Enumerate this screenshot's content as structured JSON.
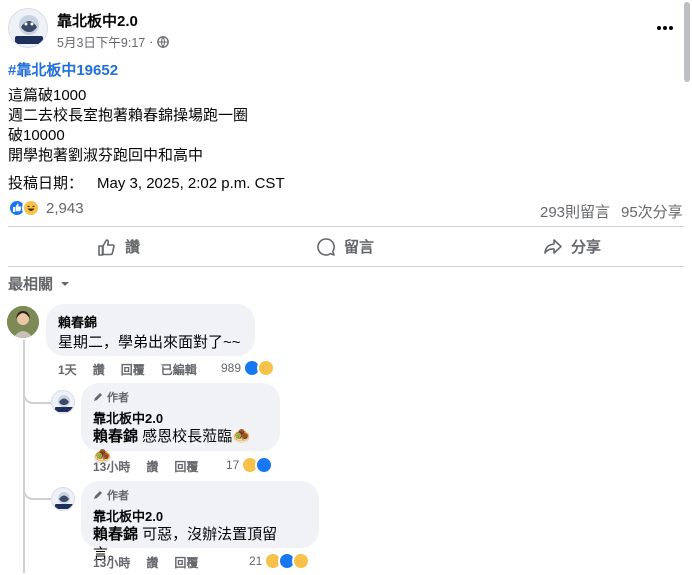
{
  "post": {
    "page_name": "靠北板中2.0",
    "timestamp": "5月3日下午9:17",
    "privacy_dot": "·",
    "hashtag": "#靠北板中19652",
    "lines": [
      "這篇破1000",
      "週二去校長室抱著賴春錦操場跑一圈",
      "破10000",
      "開學抱著劉淑芬跑回中和高中"
    ],
    "submit_label": "投稿日期：",
    "submit_date": "May 3, 2025, 2:02 p.m. CST",
    "reaction_count": "2,943",
    "comment_count": "293則留言",
    "share_count": "95次分享"
  },
  "actions": {
    "like": "讚",
    "comment": "留言",
    "share": "分享"
  },
  "sort": {
    "label": "最相關"
  },
  "comments": [
    {
      "author": "賴春錦",
      "text": "星期二，學弟出來面對了~~",
      "time": "1天",
      "like": "讚",
      "reply": "回覆",
      "edited": "已編輯",
      "reactions": "989"
    }
  ],
  "replies": [
    {
      "badge": "作者",
      "author": "靠北板中2.0",
      "mention": "賴春錦",
      "text": " 感恩校長蒞臨",
      "emoji": "🧆🧆",
      "time": "13小時",
      "like": "讚",
      "reply": "回覆",
      "reactions": "17"
    },
    {
      "badge": "作者",
      "author": "靠北板中2.0",
      "mention": "賴春錦",
      "text": " 可惡，沒辦法置頂留言。",
      "time": "13小時",
      "like": "讚",
      "reply": "回覆",
      "reactions": "21"
    }
  ],
  "logo_text": "靠北板中",
  "colors": {
    "accent": "#1877f2",
    "hashtag": "#216fdb",
    "muted": "#65676b",
    "bubble": "#f0f2f5"
  }
}
